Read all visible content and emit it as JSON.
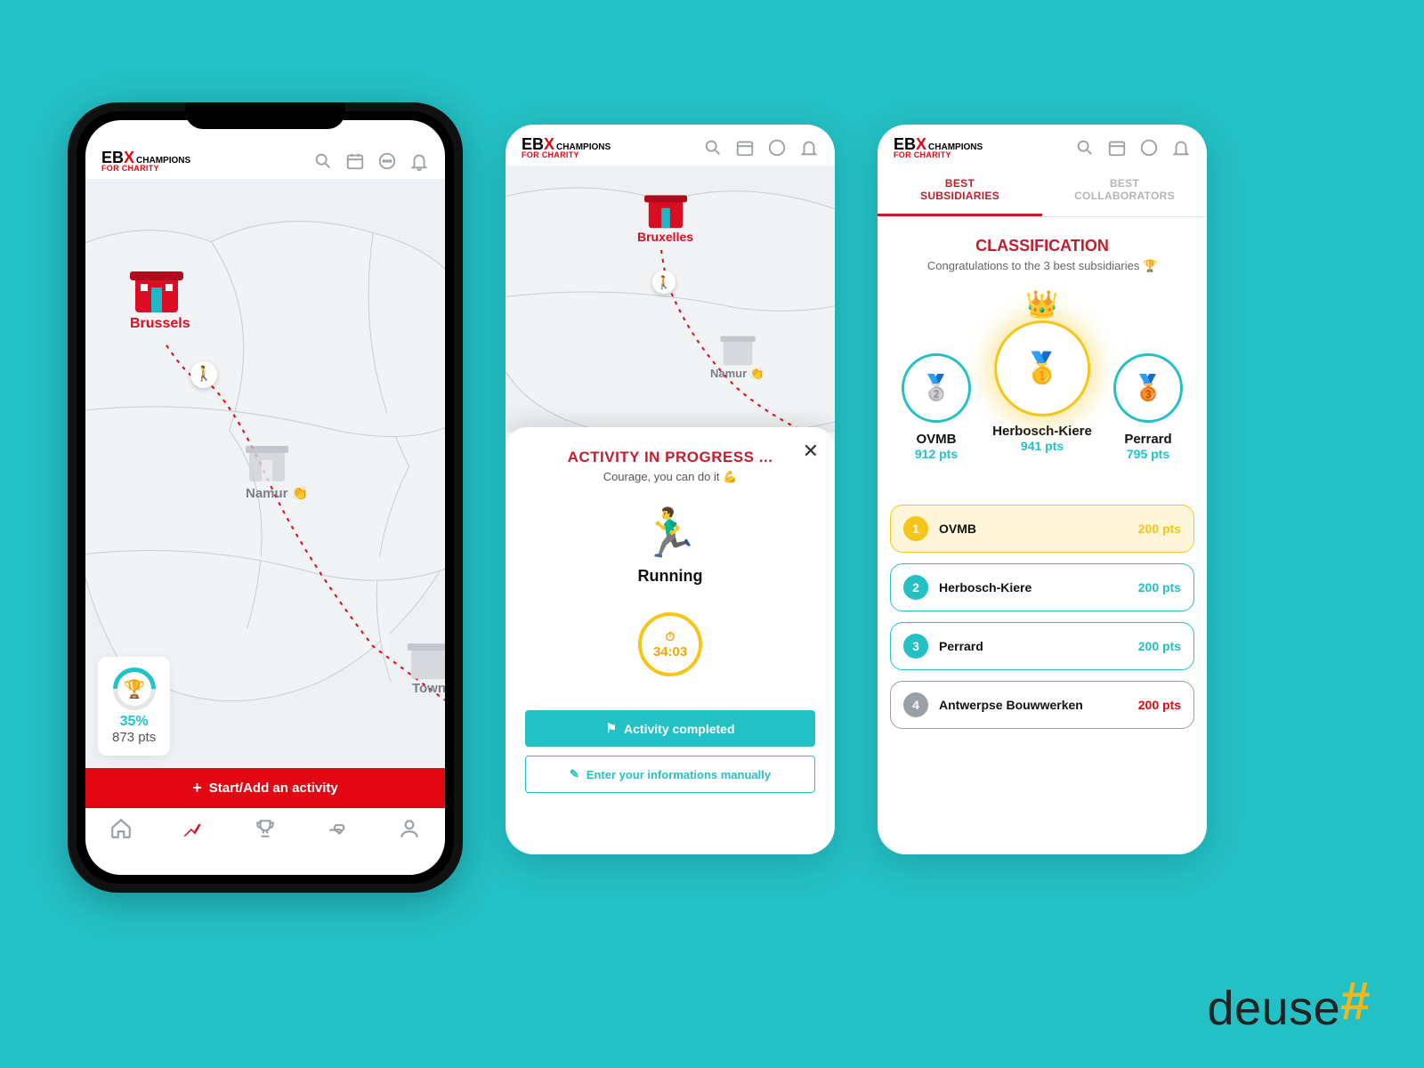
{
  "brand": {
    "logo_main": "EB",
    "logo_x": "X",
    "logo_tag1": "CHAMPIONS",
    "logo_tag2": "FOR CHARITY"
  },
  "footer_brand": "deuse",
  "screen1": {
    "cities": {
      "start": "Brussels",
      "mid": "Namur",
      "end": "Town"
    },
    "progress": {
      "pct": "35%",
      "pts": "873 pts"
    },
    "start_btn": "Start/Add an activity"
  },
  "screen2": {
    "cities": {
      "start": "Bruxelles",
      "mid": "Namur"
    },
    "modal": {
      "title": "ACTIVITY IN PROGRESS ...",
      "subtitle": "Courage, you can do it 💪",
      "activity": "Running",
      "timer": "34:03",
      "btn_done": "Activity completed",
      "btn_manual": "Enter your informations manually"
    }
  },
  "screen3": {
    "tabs": {
      "active": "BEST SUBSIDIARIES",
      "other": "BEST COLLABORATORS"
    },
    "title": "CLASSIFICATION",
    "subtitle": "Congratulations to the 3 best subsidiaries 🏆",
    "podium": {
      "first": {
        "name": "Herbosch-Kiere",
        "pts": "941 pts"
      },
      "second": {
        "name": "OVMB",
        "pts": "912 pts"
      },
      "third": {
        "name": "Perrard",
        "pts": "795 pts"
      }
    },
    "ranking": [
      {
        "n": "1",
        "name": "OVMB",
        "pts": "200 pts",
        "accent": "#f5c518",
        "bg": "#fff6d9"
      },
      {
        "n": "2",
        "name": "Herbosch-Kiere",
        "pts": "200 pts",
        "accent": "#23c0c5",
        "bg": "#ffffff"
      },
      {
        "n": "3",
        "name": "Perrard",
        "pts": "200 pts",
        "accent": "#23c0c5",
        "bg": "#ffffff"
      },
      {
        "n": "4",
        "name": "Antwerpse Bouwwerken",
        "pts": "200 pts",
        "accent": "#9aa0a6",
        "bg": "#ffffff",
        "pts_color": "#e30613"
      }
    ]
  }
}
